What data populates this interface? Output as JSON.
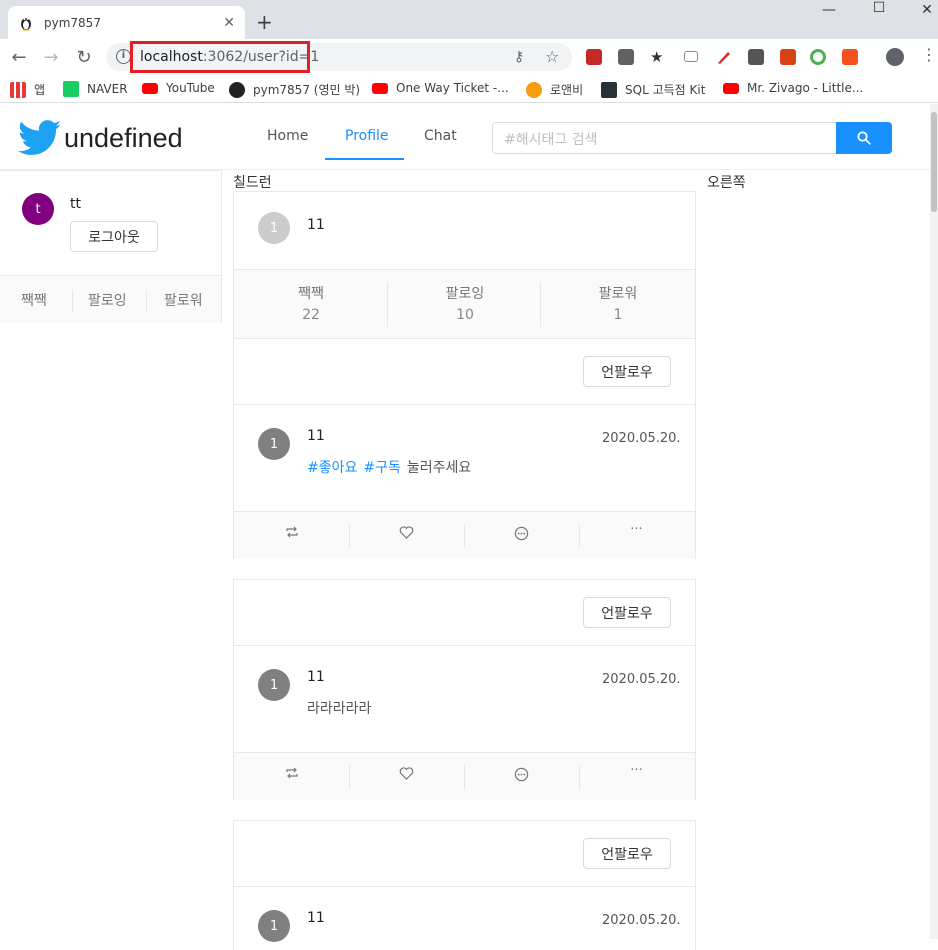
{
  "browser": {
    "tab_title": "pym7857",
    "url_host": "localhost",
    "url_path": ":3062/user?id=1",
    "bookmarks": [
      "앱",
      "NAVER",
      "YouTube",
      "pym7857 (영민 박)",
      "One Way Ticket -...",
      "로앤비",
      "SQL 고득점 Kit",
      "Mr. Zivago - Little..."
    ]
  },
  "header": {
    "brand": "undefined",
    "menu": [
      "Home",
      "Profile",
      "Chat"
    ],
    "search_placeholder": "#해시태그 검색"
  },
  "left": {
    "avatar_letter": "t",
    "nickname": "tt",
    "logout_label": "로그아웃",
    "stats": [
      "짹짹",
      "팔로잉",
      "팔로워"
    ]
  },
  "middle": {
    "title": "칠드런",
    "profile": {
      "avatar_letter": "1",
      "nickname": "11",
      "stats": [
        {
          "label": "짹짹",
          "value": "22"
        },
        {
          "label": "팔로잉",
          "value": "10"
        },
        {
          "label": "팔로워",
          "value": "1"
        }
      ]
    },
    "posts": [
      {
        "unfollow_label": "언팔로우",
        "avatar_letter": "1",
        "author": "11",
        "date": "2020.05.20.",
        "hashtags": [
          "#좋아요",
          "#구독"
        ],
        "text": "눌러주세요"
      },
      {
        "unfollow_label": "언팔로우",
        "avatar_letter": "1",
        "author": "11",
        "date": "2020.05.20.",
        "hashtags": [],
        "text": "라라라라라"
      },
      {
        "unfollow_label": "언팔로우",
        "avatar_letter": "1",
        "author": "11",
        "date": "2020.05.20.",
        "hashtags": [],
        "text": ""
      }
    ],
    "more_label": "···"
  },
  "right": {
    "title": "오른쪽"
  },
  "colors": {
    "accent": "#1890ff",
    "left_avatar": "#800080",
    "profile_avatar": "#cccccc",
    "post_avatar": "#808080",
    "url_highlight": "#e41e26"
  }
}
